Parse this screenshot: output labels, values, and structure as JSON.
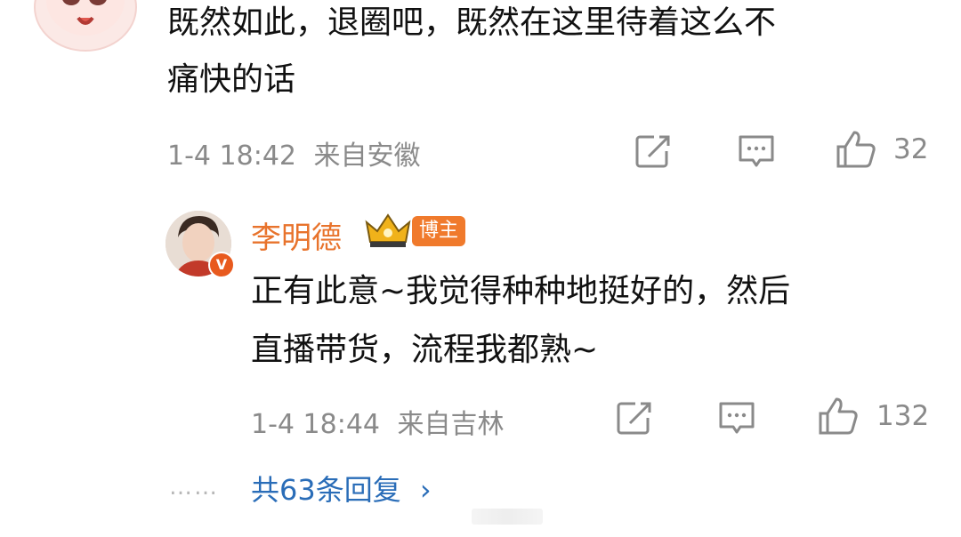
{
  "comment": {
    "text_line1": "既然如此，退圈吧，既然在这里待着这么不",
    "text_line2": "痛快的话",
    "timestamp": "1-4 18:42",
    "location": "来自安徽",
    "like_count": "32"
  },
  "reply": {
    "username": "李明德",
    "badge_label": "博主",
    "verified_mark": "V",
    "text_line1": "正有此意~我觉得种种地挺好的，然后",
    "text_line2": "直播带货，流程我都熟~",
    "timestamp": "1-4 18:44",
    "location": "来自吉林",
    "like_count": "132"
  },
  "more_replies": {
    "dots": "……",
    "label": "共63条回复",
    "chevron": "›"
  },
  "icons": {
    "share": "share-icon",
    "comment": "comment-icon",
    "like": "thumbs-up-icon",
    "crown": "crown-icon"
  },
  "colors": {
    "username": "#e8732c",
    "badge": "#f07a2c",
    "link": "#2a6db8",
    "meta": "#8a8a8a",
    "verified": "#e85a1e"
  }
}
